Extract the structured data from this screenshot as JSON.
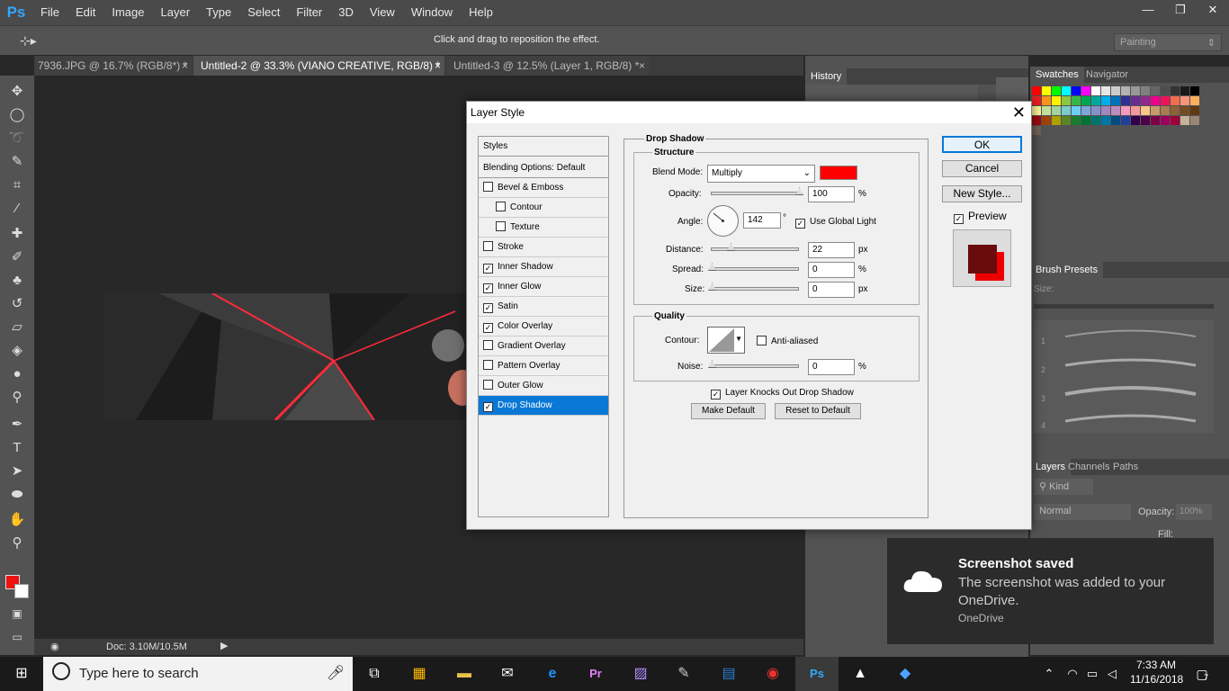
{
  "app": {
    "logo": "Ps"
  },
  "menu": [
    "File",
    "Edit",
    "Image",
    "Layer",
    "Type",
    "Select",
    "Filter",
    "3D",
    "View",
    "Window",
    "Help"
  ],
  "window_controls": [
    "—",
    "❐",
    "✕"
  ],
  "options_bar": {
    "hint": "Click and drag to reposition the effect.",
    "workspace": "Painting"
  },
  "doc_tabs": [
    {
      "label": "7936.JPG @ 16.7% (RGB/8*) *",
      "close": "×"
    },
    {
      "label": "Untitled-2 @ 33.3% (VIANO CREATIVE, RGB/8) *",
      "close": "×"
    },
    {
      "label": "Untitled-3 @ 12.5% (Layer 1, RGB/8) *",
      "close": "×"
    }
  ],
  "status_bar": {
    "doc": "Doc: 3.10M/10.5M"
  },
  "panels": {
    "history": "History",
    "swatches": "Swatches",
    "navigator": "Navigator",
    "brush_presets": "Brush Presets",
    "brush_size_label": "Size:",
    "brush_numbers": [
      "1",
      "2",
      "3",
      "4"
    ],
    "layers": "Layers",
    "channels": "Channels",
    "paths": "Paths",
    "kind": "Kind",
    "blend": "Normal",
    "opacity_label": "Opacity:",
    "opacity_val": "100%",
    "fill_label": "Fill:"
  },
  "dialog": {
    "title": "Layer Style",
    "close": "✕",
    "styles_header": "Styles",
    "blending_options": "Blending Options: Default",
    "styles": [
      {
        "label": "Bevel & Emboss",
        "checked": false,
        "indent": false
      },
      {
        "label": "Contour",
        "checked": false,
        "indent": true
      },
      {
        "label": "Texture",
        "checked": false,
        "indent": true
      },
      {
        "label": "Stroke",
        "checked": false,
        "indent": false
      },
      {
        "label": "Inner Shadow",
        "checked": true,
        "indent": false
      },
      {
        "label": "Inner Glow",
        "checked": true,
        "indent": false
      },
      {
        "label": "Satin",
        "checked": true,
        "indent": false
      },
      {
        "label": "Color Overlay",
        "checked": true,
        "indent": false
      },
      {
        "label": "Gradient Overlay",
        "checked": false,
        "indent": false
      },
      {
        "label": "Pattern Overlay",
        "checked": false,
        "indent": false
      },
      {
        "label": "Outer Glow",
        "checked": false,
        "indent": false
      },
      {
        "label": "Drop Shadow",
        "checked": true,
        "indent": false,
        "selected": true
      }
    ],
    "section_title": "Drop Shadow",
    "structure": "Structure",
    "blend_mode_label": "Blend Mode:",
    "blend_mode_value": "Multiply",
    "shadow_color": "#ff0000",
    "opacity_label": "Opacity:",
    "opacity_value": "100",
    "opacity_level": 1.0,
    "angle_label": "Angle:",
    "angle_value": "142",
    "degree_sign": "°",
    "use_global_light": "Use Global Light",
    "distance_label": "Distance:",
    "distance_value": "22",
    "spread_label": "Spread:",
    "spread_value": "0",
    "size_label": "Size:",
    "size_value": "0",
    "px": "px",
    "percent": "%",
    "quality": "Quality",
    "contour_label": "Contour:",
    "anti_aliased": "Anti-aliased",
    "noise_label": "Noise:",
    "noise_value": "0",
    "knocks_out": "Layer Knocks Out Drop Shadow",
    "make_default": "Make Default",
    "reset_default": "Reset to Default",
    "ok": "OK",
    "cancel": "Cancel",
    "new_style": "New Style...",
    "preview": "Preview"
  },
  "toast": {
    "title": "Screenshot saved",
    "body": "The screenshot was added to your OneDrive.",
    "source": "OneDrive"
  },
  "taskbar": {
    "search_placeholder": "Type here to search",
    "time": "7:33 AM",
    "date": "11/16/2018",
    "notif_count": "7"
  }
}
